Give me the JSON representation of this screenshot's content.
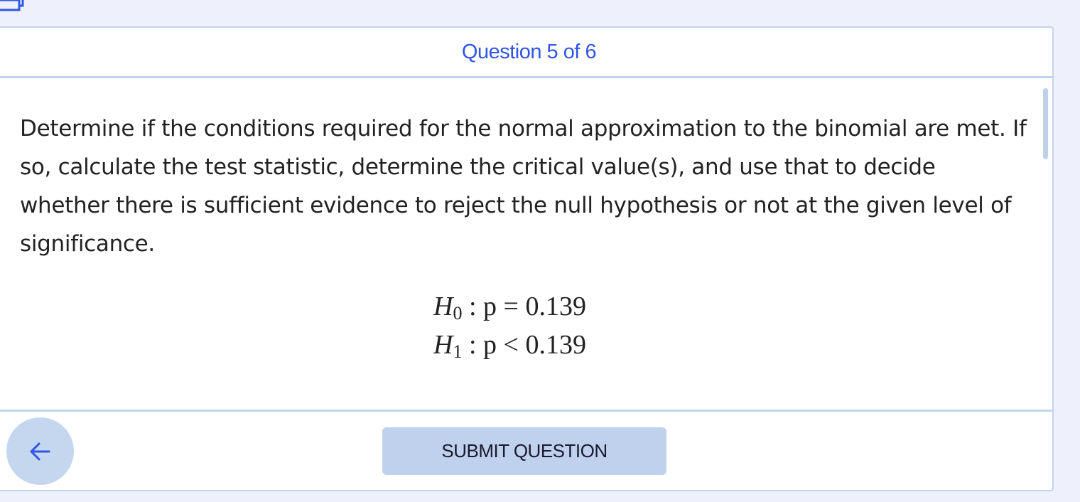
{
  "header": {
    "question_counter": "Question 5 of 6"
  },
  "question": {
    "prompt": "Determine if the conditions required for the normal approximation to the binomial are met. If so, calculate the test statistic, determine the critical value(s), and use that to decide whether there is sufficient evidence to reject the null hypothesis or not at the given level of significance.",
    "hypotheses": [
      {
        "symbol": "H",
        "subscript": "0",
        "relation": ": p = 0.139"
      },
      {
        "symbol": "H",
        "subscript": "1",
        "relation": ": p < 0.139"
      }
    ]
  },
  "footer": {
    "back_icon": "arrow-left-icon",
    "submit_label": "SUBMIT QUESTION"
  },
  "colors": {
    "accent": "#2f55e4",
    "button_bg": "#bfd1ec",
    "border": "#c3d3ea",
    "page_bg": "#eef1fb"
  }
}
